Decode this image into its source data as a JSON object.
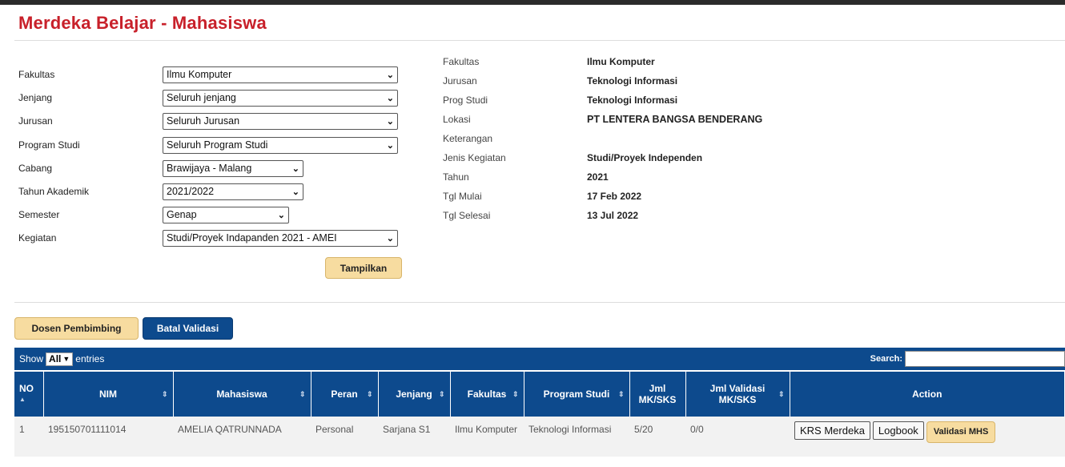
{
  "page_title": "Merdeka Belajar - Mahasiswa",
  "filters": [
    {
      "label": "Fakultas",
      "value": "Ilmu Komputer"
    },
    {
      "label": "Jenjang",
      "value": "Seluruh jenjang"
    },
    {
      "label": "Jurusan",
      "value": "Seluruh Jurusan"
    },
    {
      "label": "Program Studi",
      "value": "Seluruh Program Studi"
    },
    {
      "label": "Cabang",
      "value": "Brawijaya - Malang"
    },
    {
      "label": "Tahun Akademik",
      "value": "2021/2022"
    },
    {
      "label": "Semester",
      "value": "Genap"
    },
    {
      "label": "Kegiatan",
      "value": "Studi/Proyek Indapanden 2021 - AMEI"
    }
  ],
  "tampilkan_label": "Tampilkan",
  "info": [
    {
      "label": "Fakultas",
      "value": "Ilmu Komputer"
    },
    {
      "label": "Jurusan",
      "value": "Teknologi Informasi"
    },
    {
      "label": "Prog Studi",
      "value": "Teknologi Informasi"
    },
    {
      "label": "Lokasi",
      "value": "PT LENTERA BANGSA BENDERANG"
    },
    {
      "label": "Keterangan",
      "value": ""
    },
    {
      "label": "Jenis Kegiatan",
      "value": "Studi/Proyek Independen"
    },
    {
      "label": "Tahun",
      "value": "2021"
    },
    {
      "label": "Tgl Mulai",
      "value": "17 Feb 2022"
    },
    {
      "label": "Tgl Selesai",
      "value": "13 Jul 2022"
    }
  ],
  "buttons": {
    "dosen": "Dosen Pembimbing",
    "batal": "Batal Validasi"
  },
  "table_controls": {
    "show": "Show",
    "entries_value": "All",
    "entries": "entries",
    "search": "Search:"
  },
  "columns": [
    "NO",
    "NIM",
    "Mahasiswa",
    "Peran",
    "Jenjang",
    "Fakultas",
    "Program Studi",
    "Jml MK/SKS",
    "Jml Validasi MK/SKS",
    "Action"
  ],
  "rows": [
    {
      "no": "1",
      "nim": "195150701111014",
      "mahasiswa": "AMELIA QATRUNNADA",
      "peran": "Personal",
      "jenjang": "Sarjana S1",
      "fakultas": "Ilmu Komputer",
      "prodi": "Teknologi Informasi",
      "jml": "5/20",
      "jml_validasi": "0/0",
      "actions": {
        "krs": "KRS Merdeka",
        "logbook": "Logbook",
        "validasi": "Validasi MHS"
      }
    }
  ],
  "colors": {
    "brand_red": "#c8202a",
    "navy": "#0d4a8d",
    "gold": "#f7dca0"
  }
}
